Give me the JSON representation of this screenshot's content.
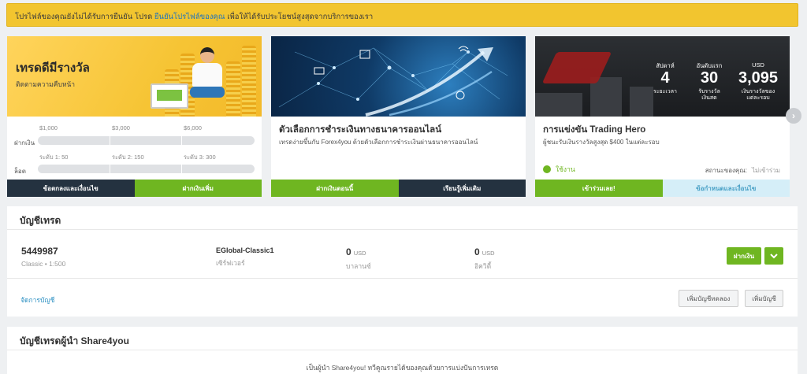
{
  "notice": {
    "text_before": "โปรไฟล์ของคุณยังไม่ได้รับการยืนยัน โปรด ",
    "link": "ยืนยันโปรไฟล์ของคุณ",
    "text_after": " เพื่อให้ได้รับประโยชน์สูงสุดจากบริการของเรา"
  },
  "card1": {
    "title": "เทรดดีมีรางวัล",
    "subtitle": "ติดตามความคืบหน้า",
    "levels": [
      "$1,000",
      "$3,000",
      "$6,000"
    ],
    "deposit_label": "ฝากเงิน",
    "lot_label": "ล็อต",
    "tiers": [
      "ระดับ 1: 50",
      "ระดับ 2: 150",
      "ระดับ 3: 300"
    ],
    "btn_terms": "ข้อตกลงและเงื่อนไข",
    "btn_deposit_more": "ฝากเงินเพิ่ม"
  },
  "card2": {
    "title": "ตัวเลือกการชำระเงินทางธนาคารออนไลน์",
    "desc": "เทรดง่ายขึ้นกับ Forex4you ด้วยตัวเลือกการชำระเงินผ่านธนาคารออนไลน์",
    "btn_deposit_now": "ฝากเงินตอนนี้",
    "btn_learn_more": "เรียนรู้เพิ่มเติม"
  },
  "card3": {
    "stats": [
      {
        "unit": "สัปดาห์",
        "num": "4",
        "cap": "ระยะเวลา"
      },
      {
        "unit": "อันดับแรก",
        "num": "30",
        "cap": "รับรางวัลเงินสด"
      },
      {
        "unit": "USD",
        "num": "3,095",
        "cap": "เงินรางวัลของแต่ละรอบ"
      }
    ],
    "title": "การแข่งขัน Trading Hero",
    "desc": "ผู้ชนะรับเงินรางวัลสูงสุด $400 ในแต่ละรอบ",
    "status": "ใช้งาน",
    "my_status_label": "สถานะของคุณ:",
    "my_status_value": "ไม่เข้าร่วม",
    "btn_join": "เข้าร่วมเลย!",
    "btn_terms": "ข้อกำหนดและเงื่อนไข"
  },
  "accounts": {
    "heading": "บัญชีเทรด",
    "account": {
      "number": "5449987",
      "type": "Classic • 1:500",
      "server": "EGlobal-Classic1",
      "server_label": "เซิร์ฟเวอร์",
      "balance": "0",
      "balance_currency": "USD",
      "balance_label": "บาลานซ์",
      "equity": "0",
      "equity_currency": "USD",
      "equity_label": "อิควิตี้"
    },
    "deposit_btn": "ฝากเงิน",
    "manage_link": "จัดการบัญชี",
    "add_demo": "เพิ่มบัญชีทดลอง",
    "add_account": "เพิ่มบัญชี"
  },
  "share4you": {
    "heading": "บัญชีเทรดผู้นำ Share4you",
    "body": "เป็นผู้นำ Share4you! ทวีคูณรายได้ของคุณด้วยการแบ่งปันการเทรด"
  },
  "colors": {
    "notice_bg": "#f2c52f",
    "green": "#6fb621",
    "dark": "#243240",
    "link": "#2a8fc2"
  }
}
